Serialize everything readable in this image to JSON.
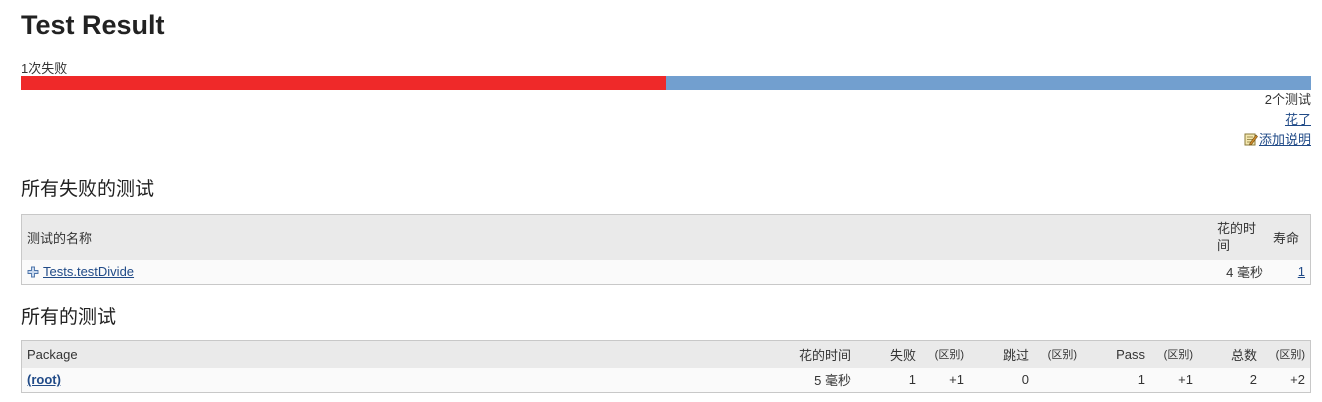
{
  "header": {
    "title": "Test Result",
    "fail_summary": "1次失败"
  },
  "progress": {
    "fail_fraction": 0.5,
    "fail_color": "#ef2929",
    "pass_color": "#729fcf"
  },
  "summary": {
    "test_count": "2个测试",
    "took_link": "花了",
    "add_description": "添加说明"
  },
  "failed_section": {
    "heading": "所有失败的测试",
    "columns": {
      "name": "测试的名称",
      "duration": "花的时间",
      "age": "寿命"
    },
    "rows": [
      {
        "name": "Tests.testDivide",
        "duration": "4 毫秒",
        "age": "1"
      }
    ]
  },
  "all_section": {
    "heading": "所有的测试",
    "columns": {
      "package": "Package",
      "duration": "花的时间",
      "fail": "失败",
      "fail_diff": "(区别)",
      "skip": "跳过",
      "skip_diff": "(区别)",
      "pass": "Pass",
      "pass_diff": "(区别)",
      "total": "总数",
      "total_diff": "(区别)"
    },
    "rows": [
      {
        "package": "(root)",
        "duration": "5 毫秒",
        "fail": "1",
        "fail_diff": "+1",
        "skip": "0",
        "skip_diff": "",
        "pass": "1",
        "pass_diff": "+1",
        "total": "2",
        "total_diff": "+2"
      }
    ]
  },
  "icons": {
    "expand": "plus-icon",
    "edit": "notepad-edit-icon"
  }
}
